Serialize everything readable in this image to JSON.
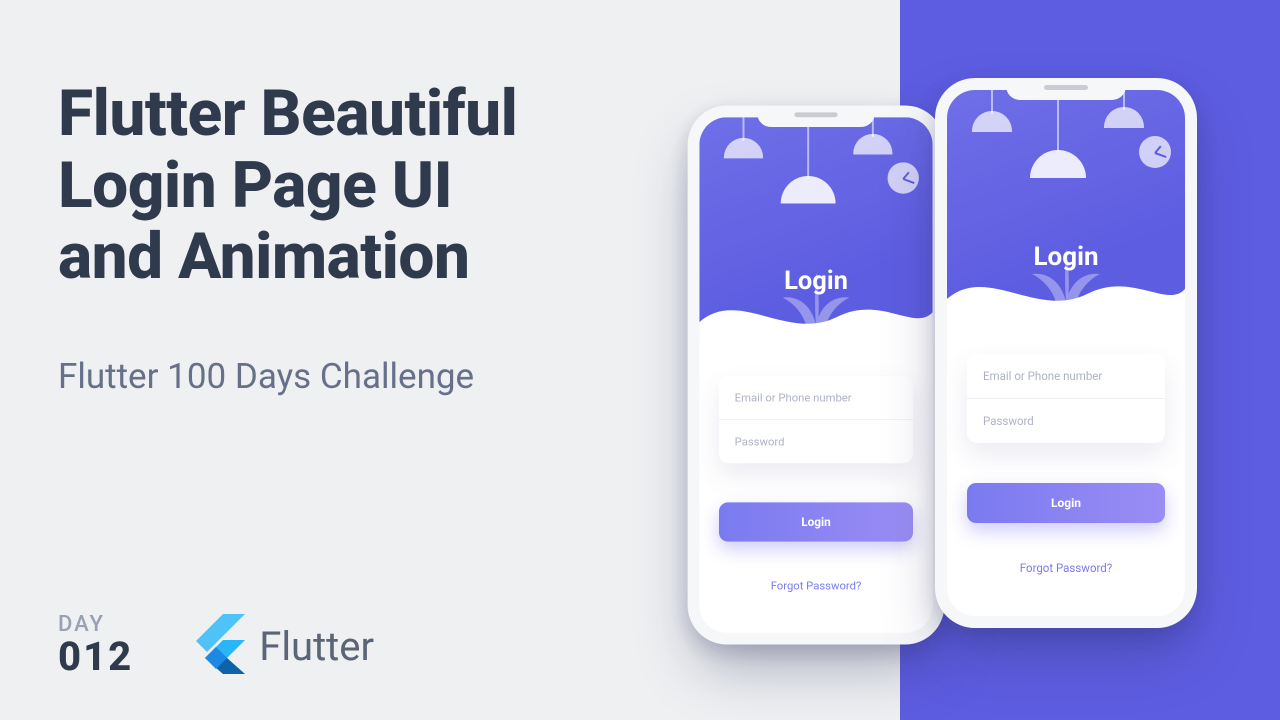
{
  "title_line1": "Flutter Beautiful",
  "title_line2": "Login Page UI",
  "title_line3": "and Animation",
  "subtitle": "Flutter 100 Days Challenge",
  "day_label": "DAY",
  "day_number": "012",
  "brand_word": "Flutter",
  "phone": {
    "hero_title": "Login",
    "email_placeholder": "Email or Phone number",
    "password_placeholder": "Password",
    "login_button": "Login",
    "forgot_password": "Forgot Password?"
  },
  "colors": {
    "accent": "#5d5de1",
    "text_dark": "#2f3a4d",
    "text_muted": "#667189"
  }
}
